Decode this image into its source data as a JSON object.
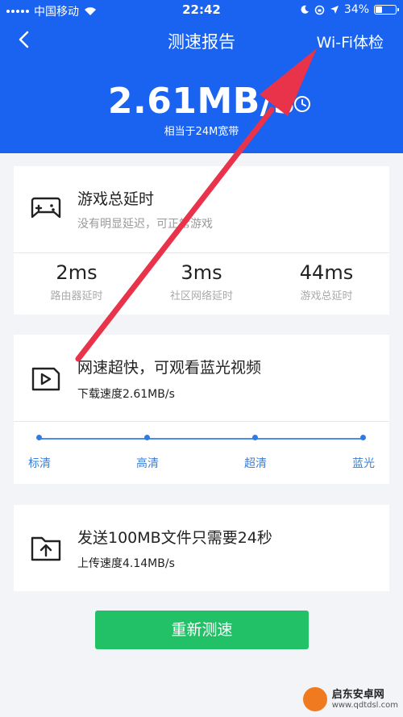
{
  "status_bar": {
    "carrier": "中国移动",
    "time": "22:42",
    "battery": "34%",
    "battery_level": 0.34
  },
  "nav": {
    "title": "测速报告",
    "right_action": "Wi-Fi体检"
  },
  "speed": {
    "value": "2.61MB/s",
    "equivalent": "相当于24M宽带"
  },
  "game_card": {
    "title": "游戏总延时",
    "subtitle": "没有明显延迟，可正常游戏",
    "metrics": [
      {
        "value": "2ms",
        "label": "路由器延时"
      },
      {
        "value": "3ms",
        "label": "社区网络延时"
      },
      {
        "value": "44ms",
        "label": "游戏总延时"
      }
    ]
  },
  "video_card": {
    "title": "网速超快，可观看蓝光视频",
    "subtitle": "下载速度2.61MB/s",
    "levels": [
      "标清",
      "高清",
      "超清",
      "蓝光"
    ]
  },
  "upload_card": {
    "title": "发送100MB文件只需要24秒",
    "subtitle": "上传速度4.14MB/s"
  },
  "retest_button": "重新测速",
  "watermark": {
    "name": "启东安卓网",
    "url": "www.qdtdsl.com"
  },
  "colors": {
    "header_blue": "#1a63f0",
    "button_green": "#22c067",
    "accent_blue": "#3a7fd8",
    "annotation_red": "#e8334a"
  }
}
